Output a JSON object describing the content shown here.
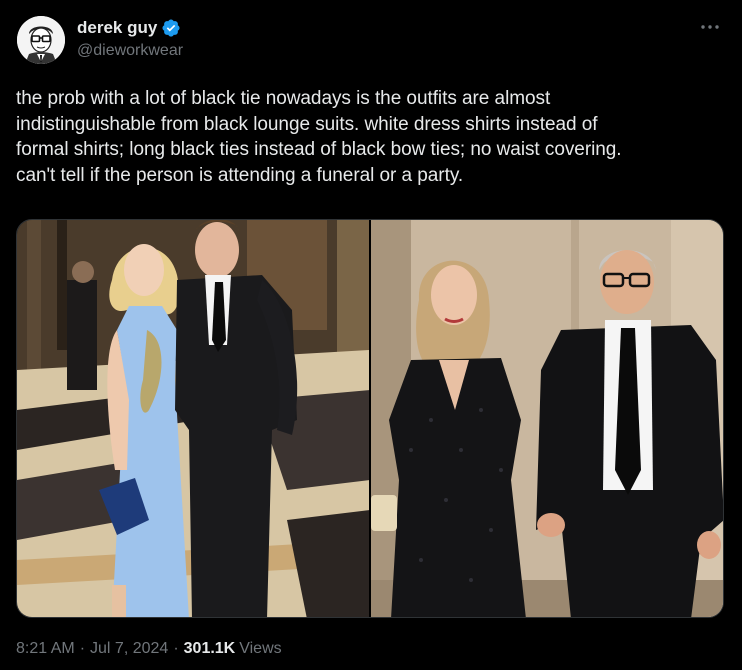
{
  "author": {
    "display_name": "derek guy",
    "handle": "@dieworkwear",
    "verified": true
  },
  "tweet": {
    "lines": [
      "the prob with a lot of black tie nowadays is the outfits are almost",
      "indistinguishable from black lounge suits. white dress shirts instead of",
      "formal shirts; long black ties instead of black bow ties; no waist covering.",
      "can't tell if the person is attending a funeral or a party."
    ]
  },
  "media": {
    "photos": [
      {
        "subject": "woman in light blue gown with embellished shoulder, man in black suit with long black tie"
      },
      {
        "subject": "woman in sequined black dress, man with glasses in black suit with long black tie"
      }
    ]
  },
  "meta": {
    "time": "8:21 AM",
    "date": "Jul 7, 2024",
    "views_count": "301.1K",
    "views_label": "Views",
    "separator": "·"
  },
  "colors": {
    "background": "#000000",
    "text_primary": "#e7e9ea",
    "text_secondary": "#71767b",
    "verified_blue": "#1d9bf0"
  },
  "icons": [
    "avatar-cartoon",
    "verified-badge-icon",
    "more-options-icon"
  ]
}
